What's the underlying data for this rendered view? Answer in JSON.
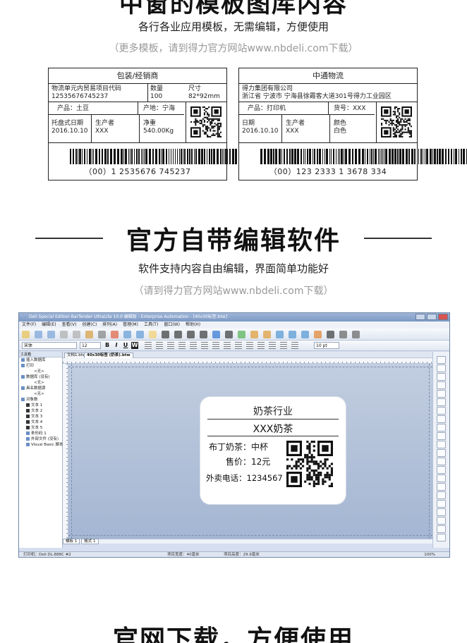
{
  "section1": {
    "title_partial": "中窗的模板图库内容",
    "subtitle": "各行各业应用模板，无需编辑，方便使用",
    "note": "（更多模板，请到得力官方网站www.nbdeli.com下载）"
  },
  "label_left": {
    "header": "包装/经销商",
    "org_line1": "物流单元内贸易项目代码",
    "org_line2": "12535676745237",
    "qty_label": "数量",
    "qty_value": "100",
    "size_label": "尺寸",
    "size_value": "82*92mm",
    "product": "产品：土豆",
    "origin": "产地：宁海",
    "date_label": "托盘式日期",
    "date_value": "2016.10.10",
    "maker_label": "生产者",
    "maker_value": "XXX",
    "weight_label": "净重",
    "weight_value": "540.00Kg",
    "barcode_text": "（00）1 2535676 745237"
  },
  "label_right": {
    "header": "中通物流",
    "company": "得力集团有限公司",
    "address": "浙江省 宁波市 宁海县徐霞客大道301号得力工业园区",
    "product": "产品：打印机",
    "goods_no": "货号：XXX",
    "date_label": "日期",
    "date_value": "2016.10.10",
    "maker_label": "生产者",
    "maker_value": "XXX",
    "color_label": "颜色",
    "color_value": "白色",
    "barcode_text": "（00）123 2333 1 3678 334"
  },
  "section2": {
    "title": "官方自带编辑软件",
    "subtitle": "软件支持内容自由编辑，界面简单功能好",
    "note": "（请到得力官方网站www.nbdeli.com下载）"
  },
  "software": {
    "window_title": "Deli Special Edition BarTender UltraLite 10.0 编辑版 - Enterprise Automation - [40x30标签.btw]",
    "menu": [
      "文件(F)",
      "编辑(E)",
      "查看(V)",
      "创建(C)",
      "排列(A)",
      "管理(M)",
      "工具(T)",
      "窗口(W)",
      "帮助(H)"
    ],
    "font_name": "宋体",
    "font_size": "12",
    "format_buttons": [
      "B",
      "I",
      "U",
      "W"
    ],
    "zoom_select": "10 pt",
    "left_tab": "工具箱",
    "tree": [
      "插入数据库",
      "打印",
      "<无>",
      "数据库 (没有)",
      "<无>",
      "具名数据源",
      "<无>",
      "对象数",
      "文本 1",
      "文本 2",
      "文本 3",
      "文本 4",
      "文本 5",
      "条形码 1",
      "外部文件 (没有)",
      "Visual Basic 脚本"
    ],
    "doc_tabs": [
      "文档1.btw",
      "40x30标签 (奶茶).btw"
    ],
    "card": {
      "title": "奶茶行业",
      "name": "XXX奶茶",
      "item": "布丁奶茶：中杯",
      "price": "售价：12元",
      "phone": "外卖电话：1234567"
    },
    "page_tabs": [
      "模板 1",
      "格式 1"
    ],
    "status": {
      "printer": "打印机：Deli DL-888C #2",
      "width": "项目宽度：40毫米",
      "height": "项目高度：29.9毫米",
      "zoom": "100%"
    }
  },
  "section3": {
    "title": "官网下载，方便使用"
  },
  "colors": {
    "canvas": "#b6c4da",
    "titlebar": "#7c98c4"
  }
}
